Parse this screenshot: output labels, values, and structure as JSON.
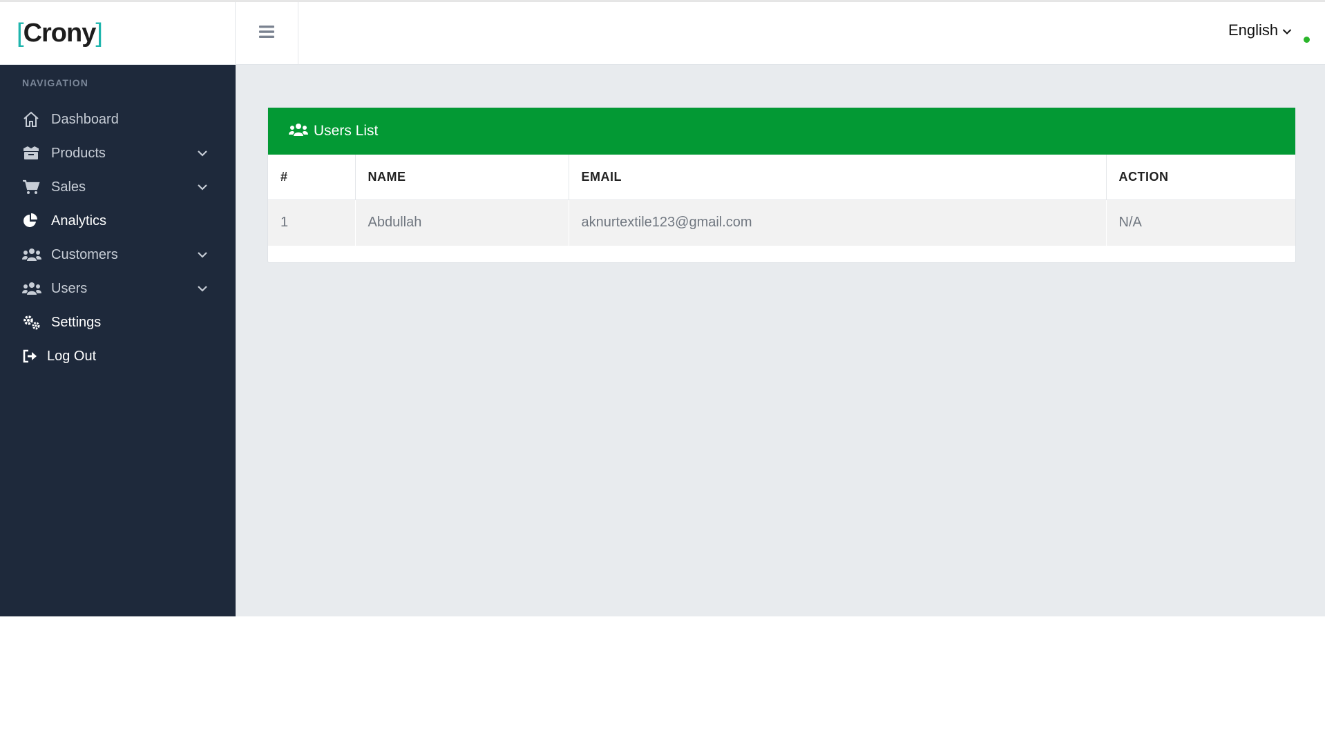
{
  "brand": {
    "name": "Crony",
    "open_bracket": "[",
    "close_bracket": "]"
  },
  "header": {
    "language": "English"
  },
  "sidebar": {
    "heading": "NAVIGATION",
    "items": [
      {
        "label": "Dashboard",
        "icon": "home-icon",
        "has_submenu": false
      },
      {
        "label": "Products",
        "icon": "box-icon",
        "has_submenu": true
      },
      {
        "label": "Sales",
        "icon": "cart-icon",
        "has_submenu": true
      },
      {
        "label": "Analytics",
        "icon": "pie-chart-icon",
        "has_submenu": false
      },
      {
        "label": "Customers",
        "icon": "users-icon",
        "has_submenu": true
      },
      {
        "label": "Users",
        "icon": "users-icon",
        "has_submenu": true
      },
      {
        "label": "Settings",
        "icon": "cogs-icon",
        "has_submenu": false
      },
      {
        "label": "Log Out",
        "icon": "logout-icon",
        "has_submenu": false
      }
    ]
  },
  "users_card": {
    "title": "Users List",
    "columns": [
      "#",
      "NAME",
      "EMAIL",
      "ACTION"
    ],
    "rows": [
      {
        "num": "1",
        "name": "Abdullah",
        "email": "aknurtextile123@gmail.com",
        "action": "N/A"
      }
    ]
  },
  "colors": {
    "sidebar_bg": "#1e293b",
    "card_header": "#039934",
    "main_bg": "#e8ebee",
    "brand_bracket": "#1fb5ad",
    "status_online": "#2ab52a"
  }
}
